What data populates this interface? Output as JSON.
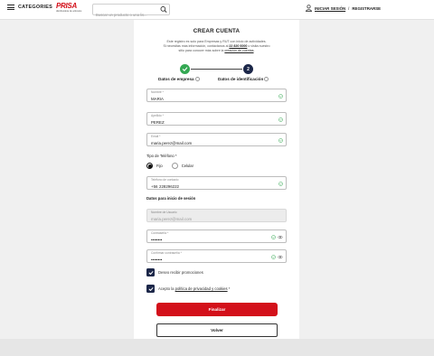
{
  "header": {
    "categories_label": "CATEGORIES",
    "logo": {
      "word": "PRISA",
      "sub": "distribuidora de artículos"
    },
    "search_placeholder": "Buscar un producto o una lis...",
    "login_label": "INICIAR SESIÓN",
    "separator": "/",
    "register_label": "REGISTRARSE"
  },
  "form": {
    "title": "CREAR CUENTA",
    "intro_line1": "Este registro es solo para Empresas y RUT con inicio de actividades.",
    "intro_line2_a": "Si necesitas más información, contáctanos al ",
    "intro_phone": "22 820 6000",
    "intro_line2_b": " o visita nuestro",
    "intro_line3_a": "sitio para conocer más sobre la ",
    "intro_link": "creación de cuentas",
    "intro_line3_b": ".",
    "steps": [
      {
        "label": "Datos de empresa",
        "number": ""
      },
      {
        "label": "Datos de identificación",
        "number": "2"
      }
    ],
    "fields": {
      "nombre": {
        "label": "Nombre *",
        "value": "MARIA"
      },
      "apellido": {
        "label": "Apellido *",
        "value": "PEREZ"
      },
      "email": {
        "label": "Email *",
        "value": "maria.perez@mail.com"
      },
      "telefono": {
        "label": "Teléfono de contacto",
        "prefix": "+56",
        "value": "228296222"
      },
      "usuario": {
        "label": "Nombre de Usuario",
        "value": "maria.perez@mail.com"
      },
      "contrasena": {
        "label": "Contraseña *",
        "value": "••••••••"
      },
      "confirmar": {
        "label": "Confirmar contraseña *",
        "value": "••••••••"
      }
    },
    "phone_type_label": "Tipo de Teléfono *",
    "phone_types": [
      "Fijo",
      "Celular"
    ],
    "session_section": "Datos para inicio de sesión",
    "promo_label": "Deseo recibir promociones",
    "terms_prefix": "Acepto la ",
    "terms_link": "política de privacidad y cookies",
    "terms_suffix": " *",
    "submit_label": "Finalizar",
    "back_label": "Volver"
  },
  "colors": {
    "brand_red": "#d3101a",
    "navy": "#1c2749",
    "success_green": "#34a853"
  }
}
